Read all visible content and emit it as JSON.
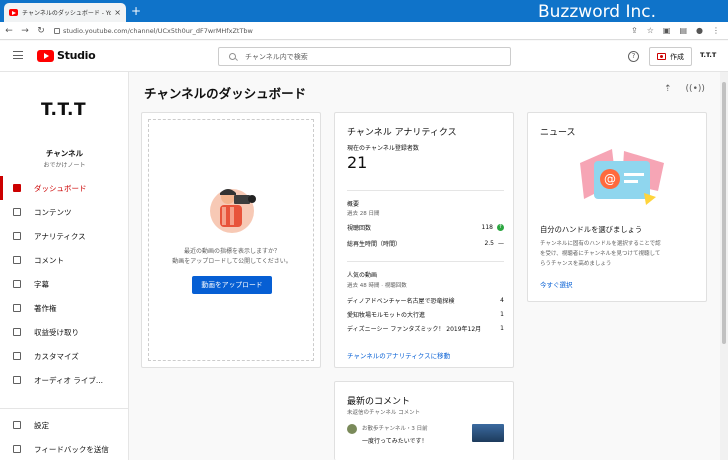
{
  "browser": {
    "tab_title": "チャンネルのダッシュボード - YouTube",
    "tab_close": "×",
    "new_tab": "+",
    "brand_overlay": "Buzzword Inc.",
    "url": "studio.youtube.com/channel/UCx5th0ur_dF7wrMHfxZtTbw",
    "back": "←",
    "forward": "→",
    "reload": "↻"
  },
  "header": {
    "logo_text": "Studio",
    "search_placeholder": "チャンネル内で検索",
    "help": "?",
    "create_label": "作成",
    "account": "T.T.T"
  },
  "sidebar": {
    "avatar_text": "T.T.T",
    "channel_label": "チャンネル",
    "channel_name": "おでかけノート",
    "items": [
      {
        "label": "ダッシュボード",
        "icon": "dashboard-icon"
      },
      {
        "label": "コンテンツ",
        "icon": "content-icon"
      },
      {
        "label": "アナリティクス",
        "icon": "analytics-icon"
      },
      {
        "label": "コメント",
        "icon": "comment-icon"
      },
      {
        "label": "字幕",
        "icon": "subtitles-icon"
      },
      {
        "label": "著作権",
        "icon": "copyright-icon"
      },
      {
        "label": "収益受け取り",
        "icon": "monetization-icon"
      },
      {
        "label": "カスタマイズ",
        "icon": "customize-icon"
      },
      {
        "label": "オーディオ ライブ...",
        "icon": "audio-library-icon"
      }
    ],
    "bottom_items": [
      {
        "label": "設定",
        "icon": "settings-icon"
      },
      {
        "label": "フィードバックを送信",
        "icon": "feedback-icon"
      }
    ]
  },
  "main": {
    "title": "チャンネルのダッシュボード",
    "upload": {
      "prompt_line1": "最近の動画の指標を表示しますか？",
      "prompt_line2": "動画をアップロードして公開してください。",
      "button": "動画をアップロード"
    },
    "analytics": {
      "title": "チャンネル アナリティクス",
      "subs_label": "現在のチャンネル登録者数",
      "subs_value": "21",
      "summary_title": "概要",
      "summary_period": "過去 28 日間",
      "views_label": "視聴回数",
      "views_value": "118",
      "views_trend": "↑",
      "watch_label": "総再生時間（時間）",
      "watch_value": "2.5",
      "watch_trend": "—",
      "top_title": "人気の動画",
      "top_period": "過去 48 時間 · 視聴回数",
      "videos": [
        {
          "title": "ディノアドベンチャー名古屋で恐竜探検",
          "views": "4"
        },
        {
          "title": "愛知牧場モルモットの大行進",
          "views": "1"
        },
        {
          "title": "ディズニーシー ファンタズミック！ 2019年12月",
          "views": "1"
        }
      ],
      "link": "チャンネルのアナリティクスに移動"
    },
    "news": {
      "title": "ニュース",
      "headline": "自分のハンドルを選びましょう",
      "body_line1": "チャンネルに固有のハンドルを選択することで認",
      "body_line2": "を受け、視聴者にチャンネルを見つけて視聴して",
      "body_line3": "らうチャンスを高めましょう",
      "link": "今すぐ選択"
    },
    "comments": {
      "title": "最新のコメント",
      "subtitle": "未返信のチャンネル コメント",
      "first_author": "お散歩チャンネル・3 日前",
      "first_text": "一度行ってみたいです！"
    }
  },
  "colors": {
    "accent_red": "#cc0000",
    "link_blue": "#065fd4",
    "chrome_blue": "#0f73c9"
  }
}
